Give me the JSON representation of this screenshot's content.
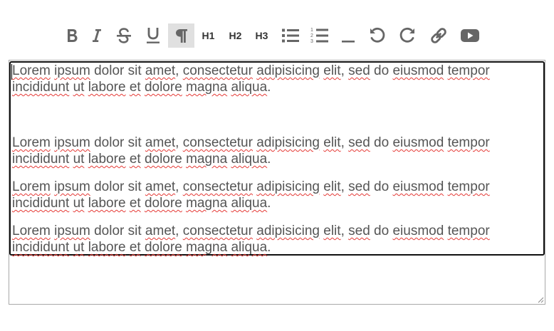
{
  "toolbar": {
    "buttons": [
      {
        "name": "bold",
        "icon": "bold-icon"
      },
      {
        "name": "italic",
        "icon": "italic-icon"
      },
      {
        "name": "strikethrough",
        "icon": "strikethrough-icon"
      },
      {
        "name": "underline",
        "icon": "underline-icon"
      },
      {
        "name": "paragraph",
        "icon": "pilcrow-icon",
        "active": true
      },
      {
        "name": "heading-1",
        "label": "H1"
      },
      {
        "name": "heading-2",
        "label": "H2"
      },
      {
        "name": "heading-3",
        "label": "H3"
      },
      {
        "name": "bullet-list",
        "icon": "bullet-list-icon"
      },
      {
        "name": "ordered-list",
        "icon": "ordered-list-icon"
      },
      {
        "name": "horizontal-rule",
        "icon": "horizontal-rule-icon"
      },
      {
        "name": "undo",
        "icon": "undo-icon"
      },
      {
        "name": "redo",
        "icon": "redo-icon"
      },
      {
        "name": "link",
        "icon": "link-icon"
      },
      {
        "name": "video",
        "icon": "video-icon"
      }
    ],
    "h1_label": "H1",
    "h2_label": "H2",
    "h3_label": "H3"
  },
  "editor": {
    "paragraphs": [
      "Lorem ipsum dolor sit amet, consectetur adipisicing elit, sed do eiusmod tempor incididunt ut labore et dolore magna aliqua.",
      "",
      "Lorem ipsum dolor sit amet, consectetur adipisicing elit, sed do eiusmod tempor incididunt ut labore et dolore magna aliqua.",
      "Lorem ipsum dolor sit amet, consectetur adipisicing elit, sed do eiusmod tempor incididunt ut labore et dolore magna aliqua.",
      "Lorem ipsum dolor sit amet, consectetur adipisicing elit, sed do eiusmod tempor incididunt ut labore et dolore magna aliqua."
    ],
    "misspelled_words": [
      "Lorem",
      "ipsum",
      "amet",
      "consectetur",
      "adipisicing",
      "elit",
      "sed",
      "eiusmod",
      "tempor",
      "incididunt",
      "ut",
      "labore",
      "et",
      "dolore",
      "magna",
      "aliqua"
    ]
  },
  "colors": {
    "icon": "#666666",
    "active_button_bg": "#e0e0e0",
    "text": "#555555",
    "spellcheck_underline": "#e53935",
    "editor_border": "#111111",
    "frame_border": "#a9a9a9"
  }
}
